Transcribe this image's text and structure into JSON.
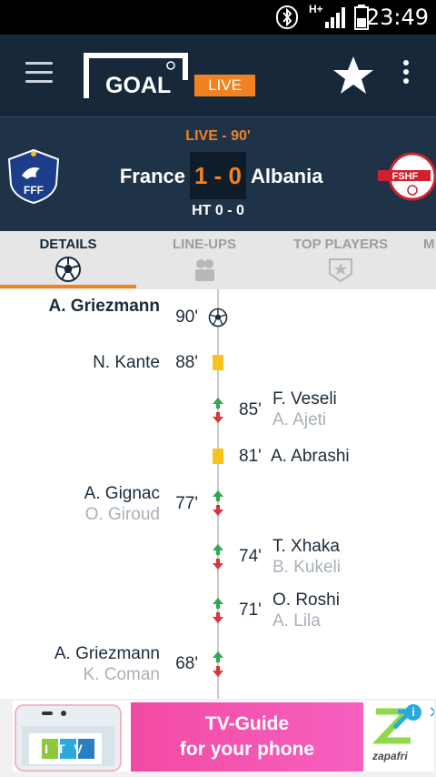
{
  "status_bar": {
    "time": "23:49",
    "network": "H+"
  },
  "app_bar": {
    "logo_text": "GOAL",
    "live_label": "LIVE"
  },
  "match": {
    "status": "LIVE - 90'",
    "home_team": "France",
    "away_team": "Albania",
    "score": "1 - 0",
    "halftime": "HT 0 - 0",
    "home_crest_text": "FFF",
    "away_crest_text": "FSHF"
  },
  "tabs": [
    {
      "label": "DETAILS",
      "icon": "soccer-ball-icon",
      "active": true
    },
    {
      "label": "LINE-UPS",
      "icon": "players-icon",
      "active": false
    },
    {
      "label": "TOP PLAYERS",
      "icon": "star-badge-icon",
      "active": false
    },
    {
      "label": "M",
      "icon": "",
      "active": false
    }
  ],
  "events": [
    {
      "minute": "90'",
      "side": "home",
      "type": "goal",
      "player": "A. Griezmann"
    },
    {
      "minute": "88'",
      "side": "home",
      "type": "yellow-card",
      "player": "N. Kante"
    },
    {
      "minute": "85'",
      "side": "away",
      "type": "substitution",
      "player_in": "F. Veseli",
      "player_out": "A. Ajeti"
    },
    {
      "minute": "81'",
      "side": "away",
      "type": "yellow-card",
      "player": "A. Abrashi"
    },
    {
      "minute": "77'",
      "side": "home",
      "type": "substitution",
      "player_in": "A. Gignac",
      "player_out": "O. Giroud"
    },
    {
      "minute": "74'",
      "side": "away",
      "type": "substitution",
      "player_in": "T. Xhaka",
      "player_out": "B. Kukeli"
    },
    {
      "minute": "71'",
      "side": "away",
      "type": "substitution",
      "player_in": "O. Roshi",
      "player_out": "A. Lila"
    },
    {
      "minute": "68'",
      "side": "home",
      "type": "substitution",
      "player_in": "A. Griezmann",
      "player_out": "K. Coman"
    }
  ],
  "ad": {
    "line1": "TV-Guide",
    "line2": "for your phone",
    "brand": "zapafri",
    "phone_text": "ITV"
  },
  "colors": {
    "app_bar": "#16283a",
    "match_header": "#1e3348",
    "accent": "#f28221",
    "yellow_card": "#f6c21b",
    "sub_in": "#2fa84f",
    "sub_out": "#d9343c"
  }
}
